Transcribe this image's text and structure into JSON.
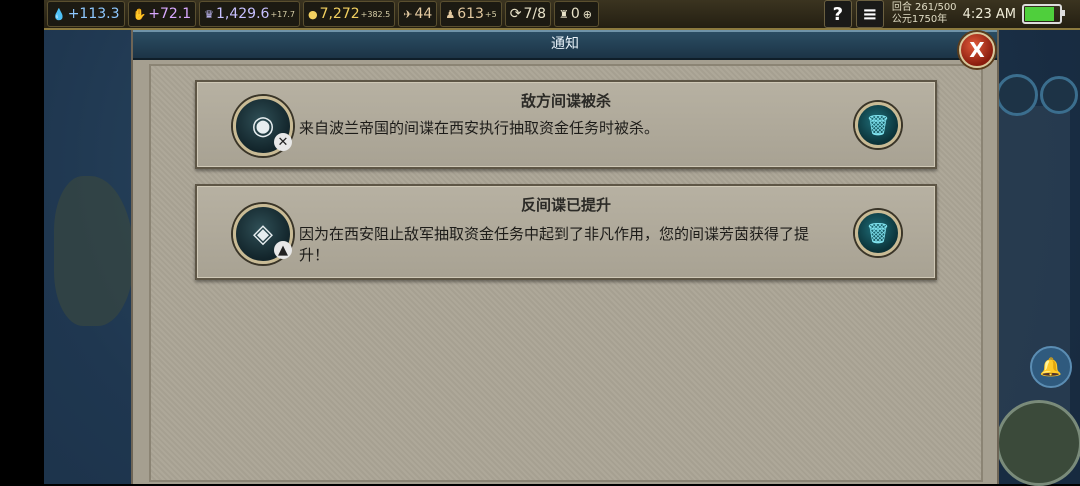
{
  "topbar": {
    "science": "+113.3",
    "faith": "+72.1",
    "culture": "1,429.6",
    "culture_delta": "+17.7",
    "gold": "7,272",
    "gold_delta": "+382.5",
    "tourism": "44",
    "great_people": "613",
    "great_people_delta": "+5",
    "trade_routes": "7/8",
    "envoys": "0",
    "help_label": "?",
    "menu_label": "≡",
    "turn": "回合 261/500",
    "year": "公元1750年",
    "clock": "4:23 AM",
    "battery_level": 0.9
  },
  "dialog": {
    "title": "通知",
    "close_label": "X"
  },
  "notifications": [
    {
      "title": "敌方间谍被杀",
      "text": "来自波兰帝国的间谍在西安执行抽取资金任务时被杀。",
      "icon": "eye-killed-icon"
    },
    {
      "title": "反间谍已提升",
      "text": "因为在西安阻止敌军抽取资金任务中起到了非凡作用，您的间谍芳茵获得了提升！",
      "icon": "eye-promoted-icon"
    }
  ],
  "colors": {
    "header_bg": "#2b4d63",
    "panel_bg": "#aba596",
    "close_red": "#c0341c"
  }
}
